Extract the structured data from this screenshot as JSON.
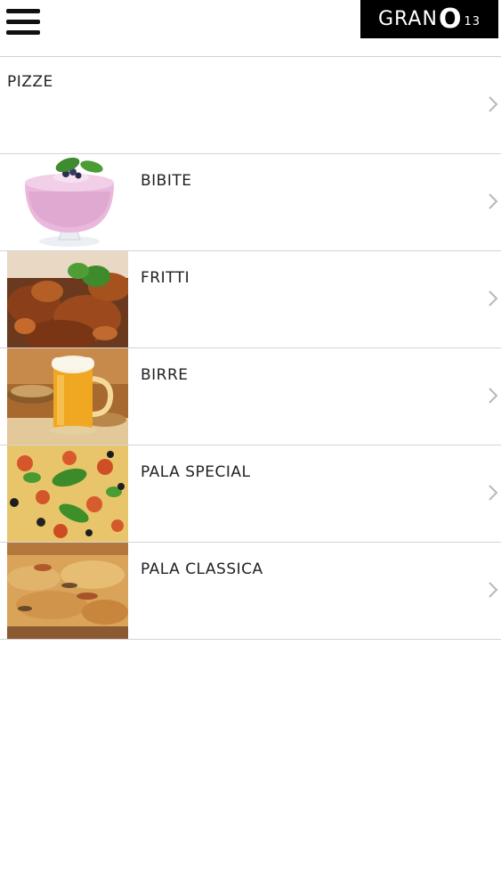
{
  "header": {
    "menu_icon": "hamburger-menu-icon",
    "logo": {
      "prefix": "GRAN",
      "o": "O",
      "suffix": "13"
    }
  },
  "menu": {
    "items": [
      {
        "label": "PIZZE",
        "image": null
      },
      {
        "label": "BIBITE",
        "image": "smoothie-glass"
      },
      {
        "label": "FRITTI",
        "image": "fried-chicken-wings"
      },
      {
        "label": "BIRRE",
        "image": "beer-mug"
      },
      {
        "label": "PALA SPECIAL",
        "image": "pizza-with-basil"
      },
      {
        "label": "PALA CLASSICA",
        "image": "pizza-slice"
      }
    ],
    "chevron_icon": "chevron-right-icon"
  },
  "colors": {
    "logo_bg": "#000000",
    "divider": "#d4d4d4",
    "text": "#222222",
    "chevron": "#b8b8b8"
  }
}
